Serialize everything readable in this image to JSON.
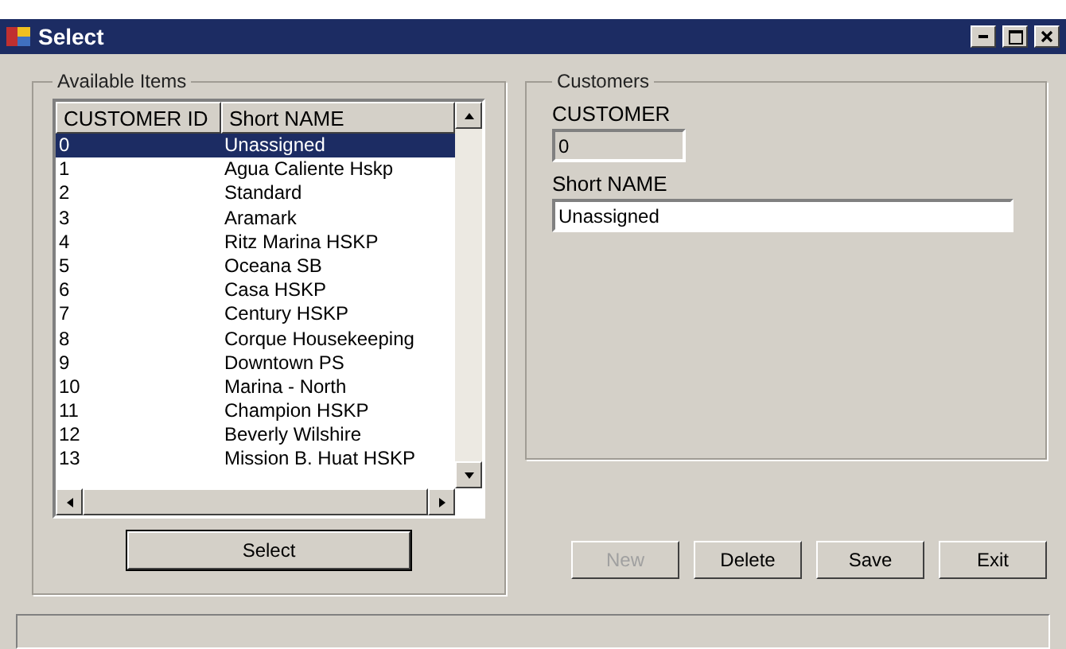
{
  "window": {
    "title": "Select"
  },
  "available_items": {
    "title": "Available Items",
    "columns": [
      "CUSTOMER ID",
      "Short NAME"
    ],
    "rows": [
      {
        "id": "0",
        "name": "Unassigned",
        "selected": true
      },
      {
        "id": "1",
        "name": "Agua Caliente Hskp",
        "selected": false
      },
      {
        "id": "2",
        "name": "Standard",
        "selected": false
      },
      {
        "id": "3",
        "name": "Aramark",
        "selected": false
      },
      {
        "id": "4",
        "name": "Ritz Marina HSKP",
        "selected": false
      },
      {
        "id": "5",
        "name": "Oceana SB",
        "selected": false
      },
      {
        "id": "6",
        "name": "Casa HSKP",
        "selected": false
      },
      {
        "id": "7",
        "name": "Century HSKP",
        "selected": false
      },
      {
        "id": "8",
        "name": "Corque Housekeeping",
        "selected": false
      },
      {
        "id": "9",
        "name": "Downtown PS",
        "selected": false
      },
      {
        "id": "10",
        "name": "Marina - North",
        "selected": false
      },
      {
        "id": "11",
        "name": "Champion HSKP",
        "selected": false
      },
      {
        "id": "12",
        "name": "Beverly Wilshire",
        "selected": false
      },
      {
        "id": "13",
        "name": "Mission B. Huat HSKP",
        "selected": false
      }
    ],
    "button": "Select"
  },
  "customers": {
    "title": "Customers",
    "fields": [
      {
        "label": "CUSTOMER",
        "value": "0",
        "disabled": true
      },
      {
        "label": "Short NAME",
        "value": "Unassigned",
        "disabled": false
      }
    ]
  },
  "buttons": [
    {
      "label": "New",
      "disabled": true
    },
    {
      "label": "Delete",
      "disabled": false
    },
    {
      "label": "Save",
      "disabled": false
    },
    {
      "label": "Exit",
      "disabled": false
    }
  ]
}
